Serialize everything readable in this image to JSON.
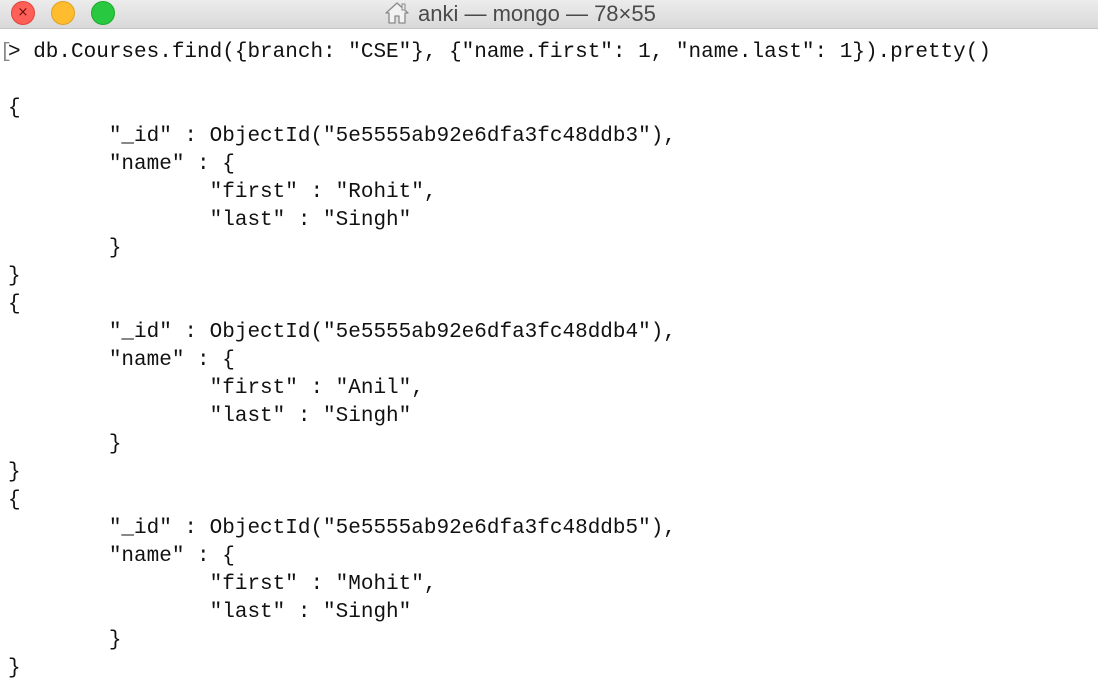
{
  "window": {
    "title": "anki — mongo — 78×55",
    "close_glyph": "×"
  },
  "terminal": {
    "mark": "[",
    "lines": [
      "> db.Courses.find({branch: \"CSE\"}, {\"name.first\": 1, \"name.last\": 1}).pretty()",
      "",
      "{",
      "        \"_id\" : ObjectId(\"5e5555ab92e6dfa3fc48ddb3\"),",
      "        \"name\" : {",
      "                \"first\" : \"Rohit\",",
      "                \"last\" : \"Singh\"",
      "        }",
      "}",
      "{",
      "        \"_id\" : ObjectId(\"5e5555ab92e6dfa3fc48ddb4\"),",
      "        \"name\" : {",
      "                \"first\" : \"Anil\",",
      "                \"last\" : \"Singh\"",
      "        }",
      "}",
      "{",
      "        \"_id\" : ObjectId(\"5e5555ab92e6dfa3fc48ddb5\"),",
      "        \"name\" : {",
      "                \"first\" : \"Mohit\",",
      "                \"last\" : \"Singh\"",
      "        }",
      "}"
    ]
  }
}
